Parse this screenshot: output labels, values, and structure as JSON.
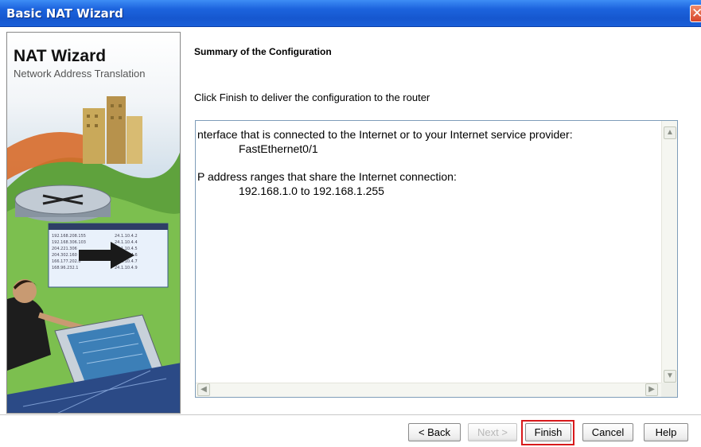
{
  "window": {
    "title": "Basic NAT Wizard",
    "close_icon": "close-icon"
  },
  "sidebar": {
    "title": "NAT Wizard",
    "subtitle": "Network Address Translation"
  },
  "main": {
    "heading": "Summary of the Configuration",
    "instruction": "Click Finish to deliver the configuration to the router",
    "summary": {
      "interface_label": "nterface that is connected to the Internet or to your Internet service provider:",
      "interface_value": "FastEthernet0/1",
      "range_label": "P address ranges that share the Internet connection:",
      "range_value": "192.168.1.0 to 192.168.1.255"
    }
  },
  "buttons": {
    "back": "< Back",
    "next": "Next >",
    "finish": "Finish",
    "cancel": "Cancel",
    "help": "Help"
  },
  "colors": {
    "titlebar": "#1c63dd",
    "highlight": "#d8191b"
  }
}
